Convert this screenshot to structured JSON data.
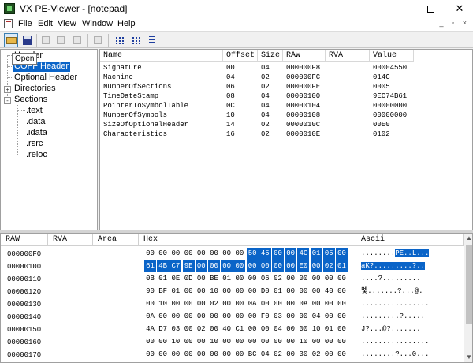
{
  "window": {
    "title": "VX PE-Viewer - [notepad]",
    "minimize_glyph": "—",
    "close_glyph": "✕"
  },
  "menu": {
    "items": [
      "File",
      "Edit",
      "View",
      "Window",
      "Help"
    ],
    "mdi_controls": "_ ▫ ×"
  },
  "toolbar": {
    "buttons": [
      "open-icon",
      "save-icon",
      "cut-icon",
      "copy-icon",
      "paste-icon",
      "print-icon",
      "view-grid-icon",
      "view-small-icon",
      "view-list-icon"
    ],
    "tooltip": "Open"
  },
  "tree": {
    "items": [
      {
        "label": "Header"
      },
      {
        "label": "COFF Header"
      },
      {
        "label": "Optional Header"
      },
      {
        "label": "Directories"
      },
      {
        "label": "Sections"
      },
      {
        "label": ".text"
      },
      {
        "label": ".data"
      },
      {
        "label": ".idata"
      },
      {
        "label": ".rsrc"
      },
      {
        "label": ".reloc"
      }
    ],
    "expand_plus": "+",
    "expand_minus": "-"
  },
  "header_list": {
    "columns": [
      "Name",
      "Offset",
      "Size",
      "RAW",
      "RVA",
      "Value"
    ],
    "rows": [
      {
        "name": "Signature",
        "offset": "00",
        "size": "04",
        "raw": "000000F8",
        "rva": "",
        "value": "00004550"
      },
      {
        "name": "Machine",
        "offset": "04",
        "size": "02",
        "raw": "000000FC",
        "rva": "",
        "value": "014C"
      },
      {
        "name": "NumberOfSections",
        "offset": "06",
        "size": "02",
        "raw": "000000FE",
        "rva": "",
        "value": "0005"
      },
      {
        "name": "TimeDateStamp",
        "offset": "08",
        "size": "04",
        "raw": "00000100",
        "rva": "",
        "value": "9EC74B61"
      },
      {
        "name": "PointerToSymbolTable",
        "offset": "0C",
        "size": "04",
        "raw": "00000104",
        "rva": "",
        "value": "00000000"
      },
      {
        "name": "NumberOfSymbols",
        "offset": "10",
        "size": "04",
        "raw": "00000108",
        "rva": "",
        "value": "00000000"
      },
      {
        "name": "SizeOfOptionalHeader",
        "offset": "14",
        "size": "02",
        "raw": "0000010C",
        "rva": "",
        "value": "00E0"
      },
      {
        "name": "Characteristics",
        "offset": "16",
        "size": "02",
        "raw": "0000010E",
        "rva": "",
        "value": "0102"
      }
    ]
  },
  "hex_view": {
    "columns": [
      "RAW",
      "RVA",
      "Area",
      "Hex",
      "Ascii"
    ],
    "selection_color": "#0a64c8",
    "rows": [
      {
        "addr": "000000F0",
        "bytes": [
          "00",
          "00",
          "00",
          "00",
          "00",
          "00",
          "00",
          "00",
          "50",
          "45",
          "00",
          "00",
          "4C",
          "01",
          "05",
          "00"
        ],
        "sel_from": 8,
        "sel_to": 15,
        "ascii_pre": "........",
        "ascii_sel": "PE..L...",
        "ascii_post": ""
      },
      {
        "addr": "00000100",
        "bytes": [
          "61",
          "4B",
          "C7",
          "9E",
          "00",
          "00",
          "00",
          "00",
          "00",
          "00",
          "00",
          "00",
          "E0",
          "00",
          "02",
          "01"
        ],
        "sel_from": 0,
        "sel_to": 15,
        "ascii_pre": "",
        "ascii_sel": "aK?.........?..",
        "ascii_post": ""
      },
      {
        "addr": "00000110",
        "bytes": [
          "0B",
          "01",
          "0E",
          "0D",
          "00",
          "BE",
          "01",
          "00",
          "00",
          "06",
          "02",
          "00",
          "00",
          "00",
          "00",
          "00"
        ],
        "sel_from": -1,
        "sel_to": -1,
        "ascii_pre": "....?.........",
        "ascii_sel": "",
        "ascii_post": ""
      },
      {
        "addr": "00000120",
        "bytes": [
          "90",
          "BF",
          "01",
          "00",
          "00",
          "10",
          "00",
          "00",
          "00",
          "D0",
          "01",
          "00",
          "00",
          "00",
          "40",
          "00"
        ],
        "sel_from": -1,
        "sel_to": -1,
        "ascii_pre": "멫.......?...@.",
        "ascii_sel": "",
        "ascii_post": ""
      },
      {
        "addr": "00000130",
        "bytes": [
          "00",
          "10",
          "00",
          "00",
          "00",
          "02",
          "00",
          "00",
          "0A",
          "00",
          "00",
          "00",
          "0A",
          "00",
          "00",
          "00"
        ],
        "sel_from": -1,
        "sel_to": -1,
        "ascii_pre": "................",
        "ascii_sel": "",
        "ascii_post": ""
      },
      {
        "addr": "00000140",
        "bytes": [
          "0A",
          "00",
          "00",
          "00",
          "00",
          "00",
          "00",
          "00",
          "00",
          "F0",
          "03",
          "00",
          "00",
          "04",
          "00",
          "00"
        ],
        "sel_from": -1,
        "sel_to": -1,
        "ascii_pre": ".........?.....",
        "ascii_sel": "",
        "ascii_post": ""
      },
      {
        "addr": "00000150",
        "bytes": [
          "4A",
          "D7",
          "03",
          "00",
          "02",
          "00",
          "40",
          "C1",
          "00",
          "00",
          "04",
          "00",
          "00",
          "10",
          "01",
          "00"
        ],
        "sel_from": -1,
        "sel_to": -1,
        "ascii_pre": "J?...@?.......",
        "ascii_sel": "",
        "ascii_post": ""
      },
      {
        "addr": "00000160",
        "bytes": [
          "00",
          "00",
          "10",
          "00",
          "00",
          "10",
          "00",
          "00",
          "00",
          "00",
          "00",
          "00",
          "10",
          "00",
          "00",
          "00"
        ],
        "sel_from": -1,
        "sel_to": -1,
        "ascii_pre": "................",
        "ascii_sel": "",
        "ascii_post": ""
      },
      {
        "addr": "00000170",
        "bytes": [
          "00",
          "00",
          "00",
          "00",
          "00",
          "00",
          "00",
          "00",
          "BC",
          "04",
          "02",
          "00",
          "30",
          "02",
          "00",
          "00"
        ],
        "sel_from": -1,
        "sel_to": -1,
        "ascii_pre": "........?...0...",
        "ascii_sel": "",
        "ascii_post": ""
      }
    ]
  }
}
